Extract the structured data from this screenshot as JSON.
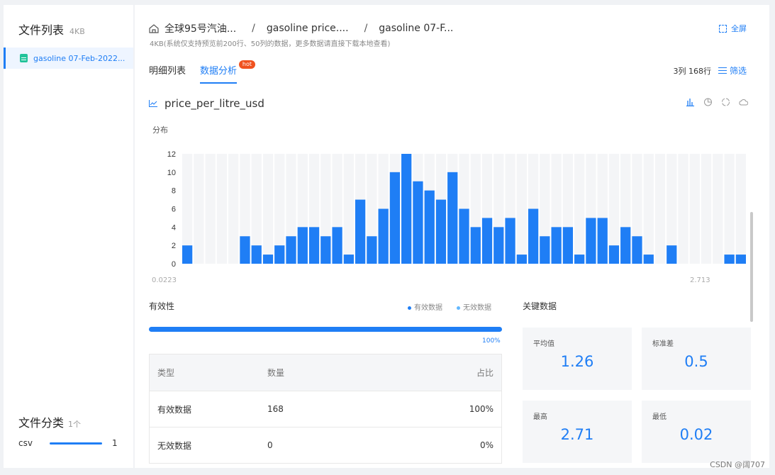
{
  "sidebar": {
    "title": "文件列表",
    "size": "4KB",
    "file": "gasoline 07-Feb-2022...",
    "category_title": "文件分类",
    "category_count": "1个",
    "categories": [
      {
        "name": "csv",
        "count": "1"
      }
    ]
  },
  "header": {
    "breadcrumb": [
      "全球95号汽油...",
      "gasoline price....",
      "gasoline 07-F..."
    ],
    "subtitle": "4KB(系统仅支持预览前200行、50列的数据，更多数据请直接下载本地查看)",
    "fullscreen": "全屏"
  },
  "tabs": [
    {
      "label": "明细列表"
    },
    {
      "label": "数据分析",
      "badge": "hot"
    }
  ],
  "row_info": "3列 168行",
  "filter_label": "筛选",
  "column_name": "price_per_litre_usd",
  "dist_label": "分布",
  "x_range": {
    "min": "0.0223",
    "max": "2.713"
  },
  "chart_data": {
    "type": "bar",
    "values": [
      2,
      0,
      0,
      0,
      0,
      3,
      2,
      1,
      2,
      3,
      4,
      4,
      3,
      4,
      1,
      7,
      3,
      6,
      10,
      12,
      9,
      8,
      7,
      10,
      6,
      4,
      5,
      4,
      5,
      1,
      6,
      3,
      4,
      4,
      1,
      5,
      5,
      2,
      4,
      3,
      1,
      0,
      2,
      0,
      0,
      0,
      0,
      1,
      1
    ],
    "ylim": [
      0,
      12
    ],
    "yticks": [
      "0",
      "2",
      "4",
      "6",
      "8",
      "10",
      "12"
    ]
  },
  "validity": {
    "title": "有效性",
    "legend_valid": "有效数据",
    "legend_invalid": "无效数据",
    "percent": "100%",
    "fraction": 1.0,
    "table": {
      "headers": [
        "类型",
        "数量",
        "占比"
      ],
      "rows": [
        [
          "有效数据",
          "168",
          "100%"
        ],
        [
          "无效数据",
          "0",
          "0%"
        ]
      ]
    }
  },
  "key_stats": {
    "title": "关键数据",
    "items": [
      {
        "label": "平均值",
        "value": "1.26"
      },
      {
        "label": "标准差",
        "value": "0.5"
      },
      {
        "label": "最高",
        "value": "2.71"
      },
      {
        "label": "最低",
        "value": "0.02"
      }
    ]
  },
  "watermark": "CSDN @阔707",
  "colors": {
    "accent": "#1f7ef5",
    "bar": "#1f7ef5",
    "grid": "#f0f0f0"
  }
}
